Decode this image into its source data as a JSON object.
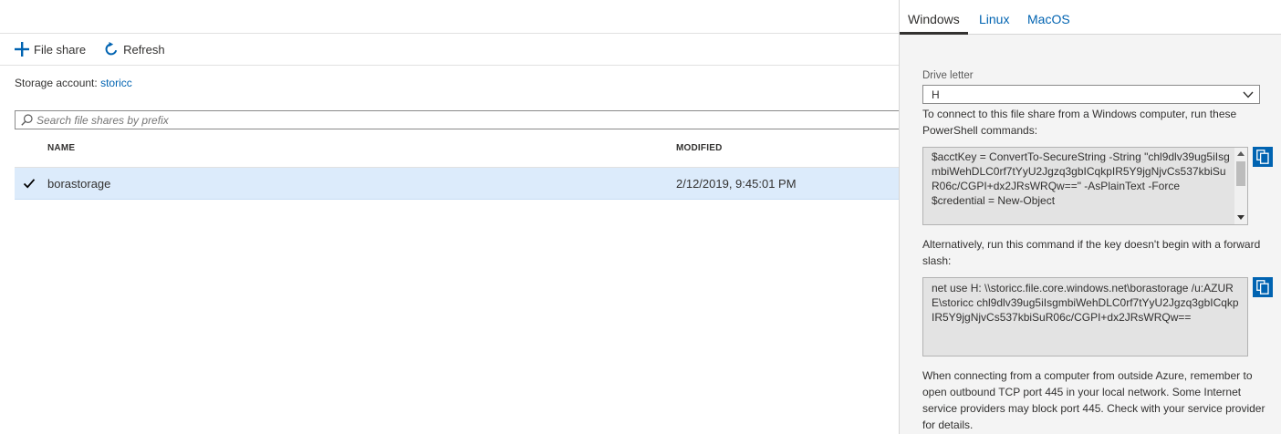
{
  "toolbar": {
    "file_share_label": "File share",
    "refresh_label": "Refresh"
  },
  "storage_account": {
    "label": "Storage account:",
    "name": "storicc"
  },
  "search": {
    "placeholder": "Search file shares by prefix"
  },
  "table": {
    "columns": [
      "NAME",
      "MODIFIED"
    ],
    "rows": [
      {
        "name": "borastorage",
        "modified": "2/12/2019, 9:45:01 PM",
        "selected": true
      }
    ]
  },
  "panel": {
    "tabs": [
      {
        "label": "Windows",
        "active": true
      },
      {
        "label": "Linux",
        "active": false
      },
      {
        "label": "MacOS",
        "active": false
      }
    ],
    "drive_letter_label": "Drive letter",
    "drive_letter_value": "H",
    "intro_text": "To connect to this file share from a Windows computer, run these PowerShell commands:",
    "powershell_code": "$acctKey = ConvertTo-SecureString -String \"chl9dlv39ug5iIsgmbiWehDLC0rf7tYyU2Jgzq3gbICqkpIR5Y9jgNjvCs537kbiSuR06c/CGPI+dx2JRsWRQw==\" -AsPlainText -Force\n$credential = New-Object",
    "alt_text": "Alternatively, run this command if the key doesn't begin with a forward slash:",
    "net_use_code": "net use H: \\\\storicc.file.core.windows.net\\borastorage /u:AZURE\\storicc chl9dlv39ug5iIsgmbiWehDLC0rf7tYyU2Jgzq3gbICqkpIR5Y9jgNjvCs537kbiSuR06c/CGPI+dx2JRsWRQw==",
    "note_text": "When connecting from a computer from outside Azure, remember to open outbound TCP port 445 in your local network. Some Internet service providers may block port 445. Check with your service provider for details."
  },
  "colors": {
    "accent": "#0063b1",
    "selected_row": "#dcebfb",
    "code_bg": "#e3e3e3",
    "panel_bg": "#f4f4f4"
  },
  "icons": {
    "add": "plus-icon",
    "refresh": "refresh-icon",
    "search": "search-icon",
    "check": "checkmark-icon",
    "chevron": "chevron-down-icon",
    "copy": "copy-icon"
  }
}
